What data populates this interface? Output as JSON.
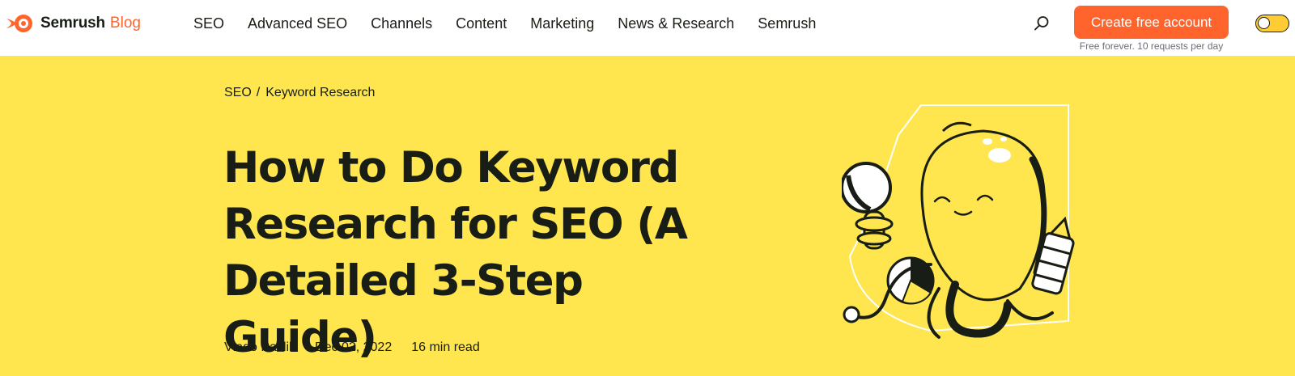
{
  "header": {
    "logo": {
      "brand": "Semrush",
      "product": "Blog",
      "icon": "semrush-fire-logo-icon"
    },
    "nav": [
      {
        "label": "SEO"
      },
      {
        "label": "Advanced SEO"
      },
      {
        "label": "Channels"
      },
      {
        "label": "Content"
      },
      {
        "label": "Marketing"
      },
      {
        "label": "News & Research"
      },
      {
        "label": "Semrush"
      }
    ],
    "search_icon": "search-icon",
    "cta": {
      "label": "Create free account",
      "note": "Free forever. 10 requests per day"
    },
    "theme_toggle": {
      "icon": "theme-toggle",
      "on": false
    }
  },
  "hero": {
    "breadcrumb": [
      {
        "label": "SEO"
      },
      {
        "label": "Keyword Research"
      }
    ],
    "breadcrumb_separator": "/",
    "title": "How to Do Keyword Research for SEO (A Detailed 3-Step Guide)",
    "meta": {
      "author": "Vlado Pavlik",
      "date": "Dec 02, 2022",
      "read_time": "16 min read"
    },
    "illustration": "octopus-with-magnifier-illustration"
  },
  "colors": {
    "brand_orange": "#ff642d",
    "hero_yellow": "#ffe54e",
    "text_dark": "#181e15",
    "muted": "#6c6e79"
  }
}
